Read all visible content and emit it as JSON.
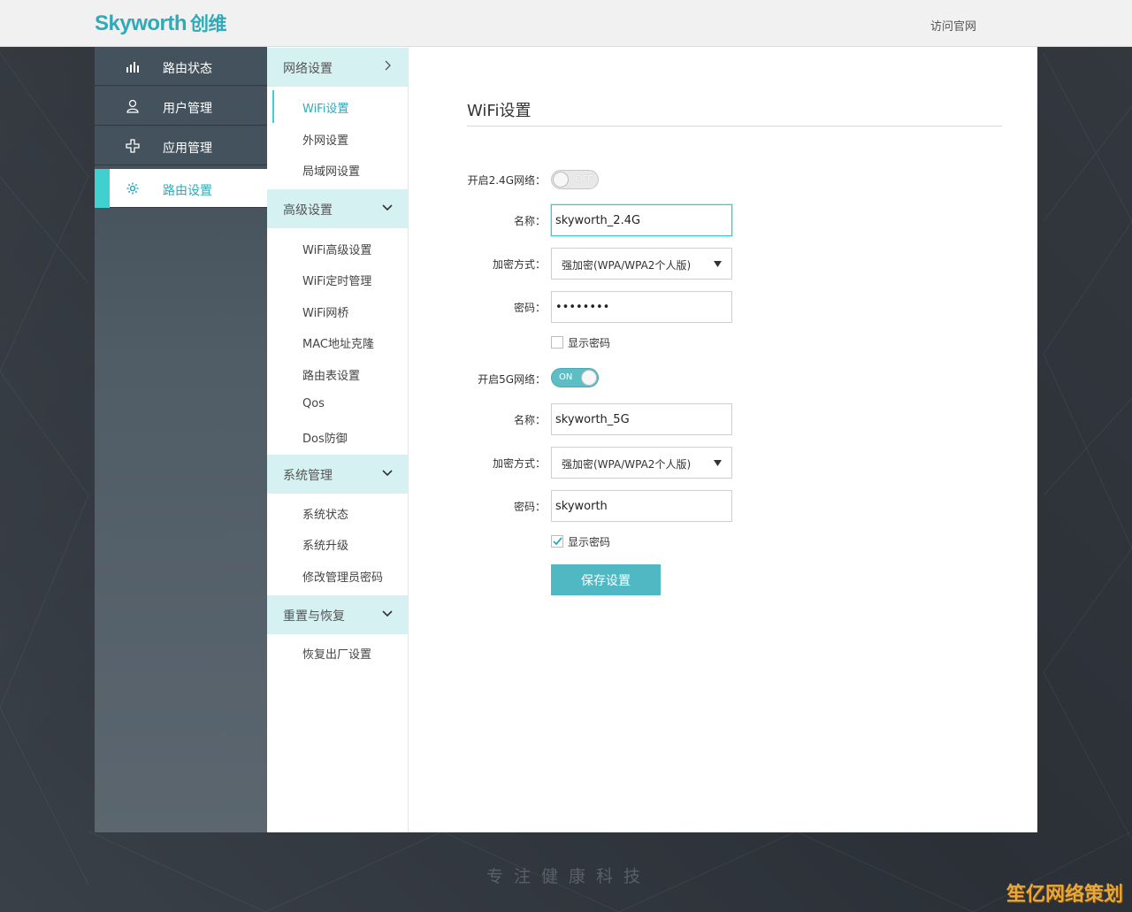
{
  "header": {
    "logo_text": "Skyworth",
    "logo_cn": "创维",
    "visit_link": "访问官网"
  },
  "sidebar": {
    "items": [
      {
        "label": "路由状态",
        "icon": "bar-chart-icon"
      },
      {
        "label": "用户管理",
        "icon": "user-icon"
      },
      {
        "label": "应用管理",
        "icon": "plus-icon"
      },
      {
        "label": "路由设置",
        "icon": "gear-icon",
        "active": true
      }
    ]
  },
  "submenu": {
    "groups": [
      {
        "title": "网络设置",
        "items": [
          "WiFi设置",
          "外网设置",
          "局域网设置"
        ]
      },
      {
        "title": "高级设置",
        "items": [
          "WiFi高级设置",
          "WiFi定时管理",
          "WiFi网桥",
          "MAC地址克隆",
          "路由表设置",
          "Qos",
          "Dos防御"
        ]
      },
      {
        "title": "系统管理",
        "items": [
          "系统状态",
          "系统升级",
          "修改管理员密码"
        ]
      },
      {
        "title": "重置与恢复",
        "items": [
          "恢复出厂设置"
        ]
      }
    ]
  },
  "main": {
    "title": "WiFi设置",
    "wifi24": {
      "toggle_label": "开启2.4G网络：",
      "toggle_state": "OFF",
      "name_label": "名称：",
      "name_value": "skyworth_2.4G",
      "enc_label": "加密方式：",
      "enc_value": "强加密(WPA/WPA2个人版)",
      "pwd_label": "密码：",
      "pwd_value": "••••••••",
      "show_pwd": "显示密码",
      "show_checked": false
    },
    "wifi5": {
      "toggle_label": "开启5G网络：",
      "toggle_state": "ON",
      "name_label": "名称：",
      "name_value": "skyworth_5G",
      "enc_label": "加密方式：",
      "enc_value": "强加密(WPA/WPA2个人版)",
      "pwd_label": "密码：",
      "pwd_value": "skyworth",
      "show_pwd": "显示密码",
      "show_checked": true
    },
    "save_label": "保存设置"
  },
  "footer": {
    "slogan": "专注健康科技",
    "watermark": "笙亿网络策划"
  },
  "colors": {
    "accent": "#2eaab8",
    "active_bar": "#3fd0cf",
    "toggle_on": "#5dbfc5",
    "save_button": "#4fb8c3"
  }
}
